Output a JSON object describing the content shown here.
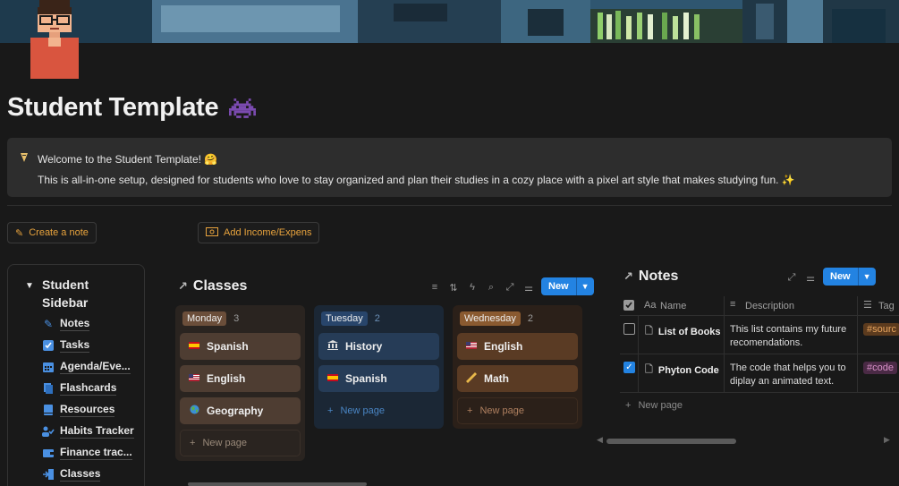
{
  "page": {
    "title": "Student Template",
    "title_icon": "space-invader-icon",
    "callout": {
      "icon": "bulb-icon",
      "line1": "Welcome to the Student Template! 🤗",
      "line2": "This is all-in-one setup, designed for students who love to stay organized and plan their studies in a cozy place with a pixel art style that makes studying fun. ✨"
    }
  },
  "buttons": {
    "create_note": "Create a note",
    "add_income": "Add Income/Expens"
  },
  "sidebar": {
    "heading": "Student Sidebar",
    "items": [
      {
        "label": "Notes",
        "icon": "pencil-icon"
      },
      {
        "label": "Tasks",
        "icon": "checkbox-icon"
      },
      {
        "label": "Agenda/Eve...",
        "icon": "calendar-icon"
      },
      {
        "label": "Flashcards",
        "icon": "cards-icon"
      },
      {
        "label": "Resources",
        "icon": "book-icon"
      },
      {
        "label": "Habits Tracker",
        "icon": "person-check-icon"
      },
      {
        "label": "Finance trac...",
        "icon": "wallet-icon"
      },
      {
        "label": "Classes",
        "icon": "enter-icon"
      }
    ]
  },
  "classes": {
    "title": "Classes",
    "new_label": "New",
    "columns": [
      {
        "name": "Monday",
        "count": "3",
        "color": "#5a4535",
        "tag_color": "#6b4e3a",
        "cards": [
          {
            "label": "Spanish",
            "flag": "es-flag"
          },
          {
            "label": "English",
            "flag": "us-flag"
          },
          {
            "label": "Geography",
            "flag": "globe"
          }
        ],
        "new_page": "New page"
      },
      {
        "name": "Tuesday",
        "count": "2",
        "color": "#1f3246",
        "tag_color": "#28456b",
        "cards": [
          {
            "label": "History",
            "flag": "museum"
          },
          {
            "label": "Spanish",
            "flag": "es-flag"
          }
        ],
        "new_page": "New page"
      },
      {
        "name": "Wednesday",
        "count": "2",
        "color": "#4b3322",
        "tag_color": "#8a5a30",
        "cards": [
          {
            "label": "English",
            "flag": "us-flag"
          },
          {
            "label": "Math",
            "flag": "ruler"
          }
        ],
        "new_page": "New page"
      }
    ]
  },
  "notes": {
    "title": "Notes",
    "new_label": "New",
    "headers": {
      "name": "Name",
      "description": "Description",
      "tag": "Tag"
    },
    "rows": [
      {
        "checked": false,
        "name": "List of Books",
        "description": "This list contains my future recomendations.",
        "tag": "#sourc",
        "tag_color": "#5c3b1e"
      },
      {
        "checked": true,
        "name": "Phyton Code",
        "description": "The code that helps you to diplay an animated text.",
        "tag": "#code",
        "tag_color": "#4a2a45"
      }
    ],
    "new_page": "New page"
  }
}
